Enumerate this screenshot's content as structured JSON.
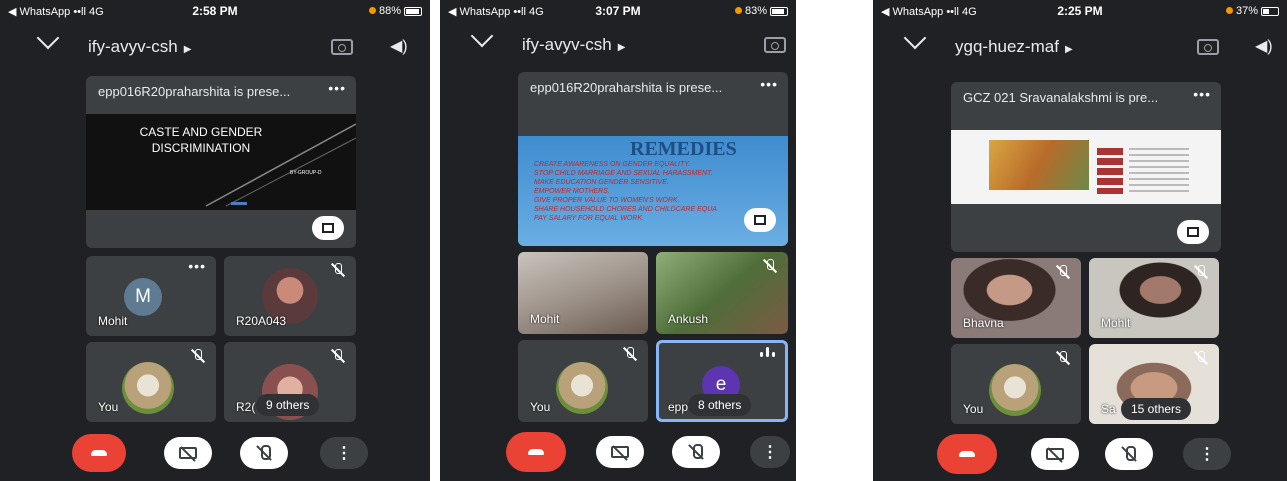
{
  "screens": [
    {
      "status": {
        "app": "◀ WhatsApp ••ll 4G",
        "time": "2:58 PM",
        "battery": "88%"
      },
      "meeting_code": "ify-avyv-csh",
      "presentation": {
        "title": "epp016R20praharshita is prese...",
        "slide_title": "CASTE AND GENDER DISCRIMINATION",
        "slide_by": "BY-GROUP-D"
      },
      "tiles": [
        {
          "name": "Mohit",
          "initial": "M"
        },
        {
          "name": "R20A043"
        },
        {
          "name": "You"
        },
        {
          "name": "R2(",
          "others": "9 others"
        }
      ]
    },
    {
      "status": {
        "app": "◀ WhatsApp ••ll 4G",
        "time": "3:07 PM",
        "battery": "83%"
      },
      "meeting_code": "ify-avyv-csh",
      "presentation": {
        "title": "epp016R20praharshita is prese...",
        "slide_title": "REMEDIES",
        "bullets": [
          "CREATE AWARENESS ON GENDER EQUALITY.",
          "STOP CHILD MARRIAGE AND SEXUAL HARASSMENT.",
          "MAKE EDUCATION GENDER SENSITIVE.",
          "EMPOWER MOTHERS.",
          "GIVE PROPER VALUE TO WOMEN'S WORK.",
          "SHARE HOUSEHOLD CHORES AND CHILDCARE EQUA",
          "PAY SALARY FOR EQUAL WORK."
        ]
      },
      "tiles": [
        {
          "name": "Mohit"
        },
        {
          "name": "Ankush"
        },
        {
          "name": "You"
        },
        {
          "name": "epp",
          "initial": "e",
          "others": "8 others"
        }
      ]
    },
    {
      "status": {
        "app": "◀ WhatsApp ••ll 4G",
        "time": "2:25 PM",
        "battery": "37%"
      },
      "meeting_code": "ygq-huez-maf",
      "presentation": {
        "title": "GCZ 021 Sravanalakshmi is pre..."
      },
      "tiles": [
        {
          "name": "Bhavna"
        },
        {
          "name": "Mohit"
        },
        {
          "name": "You"
        },
        {
          "name": "Sa",
          "others": "15 others"
        }
      ]
    }
  ],
  "icons": {
    "back": "chevron-down-icon",
    "switch_camera": "camera-switch-icon",
    "speaker": "speaker-icon",
    "mic_off": "mic-off-icon",
    "end_call": "end-call-icon",
    "video_off": "video-off-icon",
    "more": "more-options-icon"
  },
  "colors": {
    "background": "#202124",
    "tile": "#3c4043",
    "end_call": "#ea4335",
    "avatar_m": "#5f7b94",
    "avatar_e": "#5e35b1",
    "active_outline": "#8ab4f8",
    "remedies_blue": "#2e6da4"
  }
}
